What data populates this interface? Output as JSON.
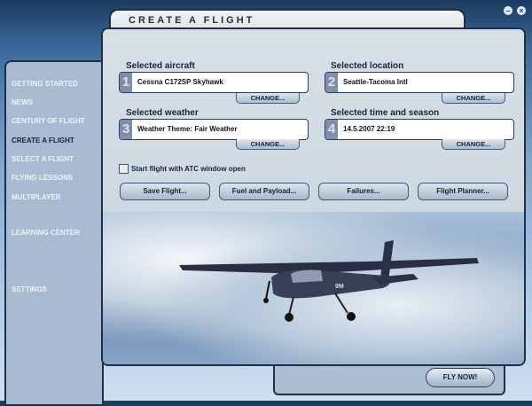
{
  "window": {
    "title": "CREATE A FLIGHT",
    "minimize": "–",
    "close": "×"
  },
  "sidebar": {
    "items": [
      {
        "label": "GETTING STARTED"
      },
      {
        "label": "NEWS"
      },
      {
        "label": "CENTURY OF FLIGHT"
      },
      {
        "label": "CREATE A FLIGHT",
        "active": true
      },
      {
        "label": "SELECT A FLIGHT"
      },
      {
        "label": "FLYING LESSONS"
      },
      {
        "label": "MULTIPLAYER"
      },
      {
        "label": "LEARNING CENTER"
      },
      {
        "label": "SETTINGS"
      }
    ]
  },
  "sections": [
    {
      "label": "Selected aircraft",
      "number": "1",
      "value": "Cessna C172SP Skyhawk",
      "change": "CHANGE..."
    },
    {
      "label": "Selected location",
      "number": "2",
      "value": "Seattle-Tacoma Intl",
      "change": "CHANGE..."
    },
    {
      "label": "Selected weather",
      "number": "3",
      "value": "Weather Theme: Fair Weather",
      "change": "CHANGE..."
    },
    {
      "label": "Selected time and season",
      "number": "4",
      "value": "14.5.2007 22:19",
      "change": "CHANGE..."
    }
  ],
  "atc_checkbox": {
    "label": "Start flight with ATC window open",
    "checked": false
  },
  "buttons": {
    "save": "Save Flight...",
    "fuel": "Fuel and Payload...",
    "failures": "Failures...",
    "planner": "Flight Planner..."
  },
  "fly_now": "FLY NOW!",
  "aircraft_registration": "9M"
}
